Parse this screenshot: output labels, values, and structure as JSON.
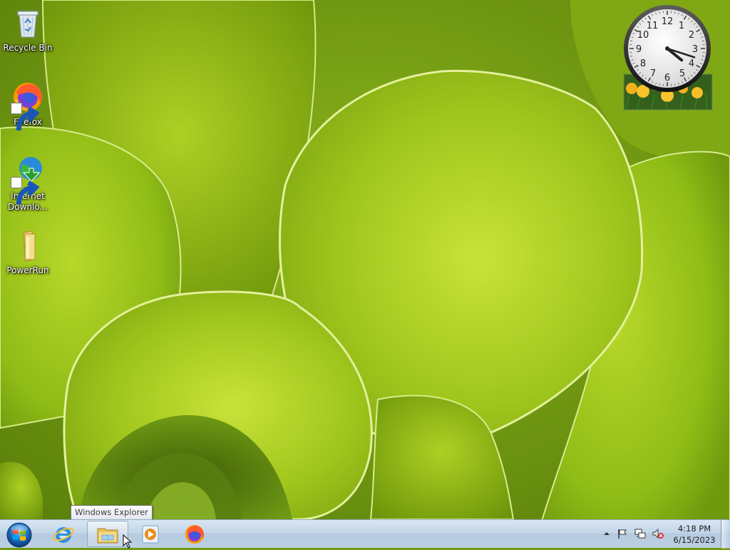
{
  "desktop": {
    "icons": [
      {
        "label": "Recycle Bin",
        "icon": "recycle-bin-icon"
      },
      {
        "label": "Firefox",
        "icon": "firefox-icon",
        "shortcut": true
      },
      {
        "label": "Internet Downlo...",
        "icon": "internet-download-manager-icon",
        "shortcut": true
      },
      {
        "label": "PowerRun",
        "icon": "folder-icon"
      }
    ]
  },
  "gadget": {
    "clock": {
      "time": "4:18"
    }
  },
  "tooltip": {
    "text": "Windows Explorer"
  },
  "taskbar": {
    "pinned": [
      {
        "name": "Internet Explorer",
        "icon": "internet-explorer-icon"
      },
      {
        "name": "Windows Explorer",
        "icon": "windows-explorer-icon"
      },
      {
        "name": "Windows Media Player",
        "icon": "media-player-icon"
      },
      {
        "name": "Firefox",
        "icon": "firefox-icon"
      }
    ],
    "tray": {
      "icons": [
        "show-hidden-icons-icon",
        "action-center-flag-icon",
        "network-icon",
        "volume-muted-icon"
      ],
      "time": "4:18 PM",
      "date": "6/15/2023"
    }
  },
  "colors": {
    "wallpaper_base": "#6f9a12",
    "leaf_light": "#c6e032",
    "taskbar": "#c3d5e8"
  }
}
